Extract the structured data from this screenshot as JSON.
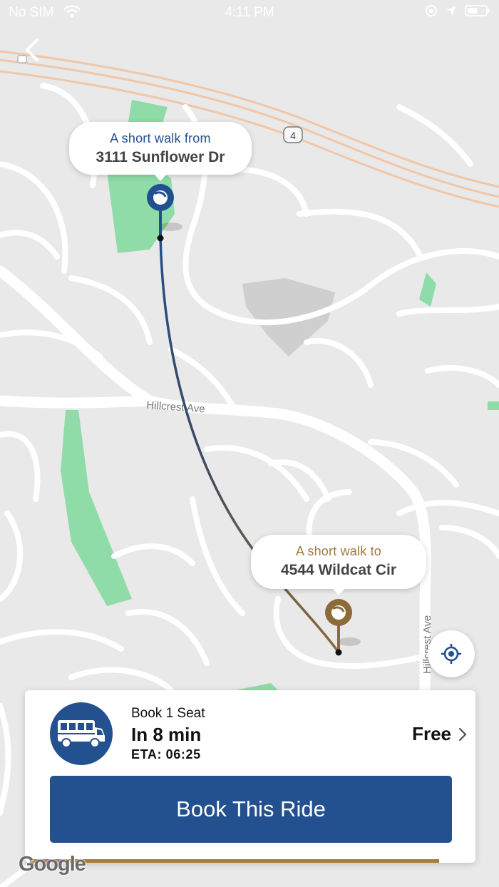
{
  "status_bar": {
    "carrier": "No SIM",
    "time": "4:11 PM"
  },
  "icons": {
    "back": "chevron-left-icon",
    "wifi": "wifi-icon",
    "rotation_lock": "rotation-lock-icon",
    "location": "location-arrow-icon",
    "battery": "battery-icon",
    "locate": "crosshair-icon",
    "bus": "bus-icon",
    "chevron": "chevron-right-icon"
  },
  "map": {
    "street_label_1": "Hillcrest Ave",
    "street_label_2": "Hillcrest Ave",
    "route_shield": "4",
    "attribution": "Google",
    "colors": {
      "background": "#e9e9e9",
      "roads": "#ffffff",
      "parks": "#8fdca8",
      "highway": "#f0c7a8",
      "route_start": "#21508f",
      "route_end": "#8c6a3a"
    }
  },
  "pickup": {
    "caption": "A short walk from",
    "address": "3111 Sunflower Dr",
    "color": "#21508f"
  },
  "dropoff": {
    "caption": "A short walk to",
    "address": "4544 Wildcat Cir",
    "color": "#a07a3a"
  },
  "ride": {
    "seats_label": "Book 1 Seat",
    "eta_minutes": "In 8 min",
    "eta_time": "ETA: 06:25",
    "price": "Free",
    "book_label": "Book This Ride",
    "accent_color": "#23508f"
  }
}
